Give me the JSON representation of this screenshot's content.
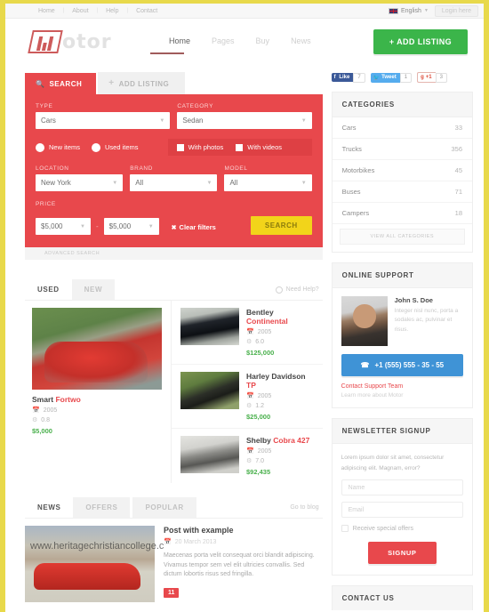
{
  "topbar": {
    "nav": [
      "Home",
      "About",
      "Help",
      "Contact"
    ],
    "language": "English",
    "login": "Login here"
  },
  "header": {
    "logo_text": "otor",
    "nav": [
      {
        "label": "Home",
        "active": true
      },
      {
        "label": "Pages",
        "active": false
      },
      {
        "label": "Buy",
        "active": false
      },
      {
        "label": "News",
        "active": false
      }
    ],
    "add_listing": "+ ADD LISTING"
  },
  "search": {
    "tab_search": "SEARCH",
    "tab_add_listing": "ADD LISTING",
    "type_label": "TYPE",
    "type_value": "Cars",
    "category_label": "CATEGORY",
    "category_value": "Sedan",
    "new_items": "New items",
    "used_items": "Used items",
    "with_photos": "With photos",
    "with_videos": "With videos",
    "location_label": "LOCATION",
    "location_value": "New York",
    "brand_label": "BRAND",
    "brand_value": "All",
    "model_label": "MODEL",
    "model_value": "All",
    "price_label": "PRICE",
    "price_min": "$5,000",
    "price_max": "$5,000",
    "clear_filters": "Clear filters",
    "search_button": "SEARCH",
    "advanced_search": "ADVANCED SEARCH"
  },
  "listings": {
    "tabs": [
      {
        "label": "USED",
        "active": true
      },
      {
        "label": "NEW",
        "active": false
      }
    ],
    "need_help": "Need Help?",
    "featured": {
      "brand": "Smart",
      "model": "Fortwo",
      "year": "2005",
      "engine": "0.8",
      "price": "$5,000"
    },
    "items": [
      {
        "brand": "Bentley",
        "model": "Continental",
        "year": "2005",
        "engine": "6.0",
        "price": "$125,000",
        "thumb": "bentley"
      },
      {
        "brand": "Harley Davidson",
        "model": "TP",
        "year": "2005",
        "engine": "1.2",
        "price": "$25,000",
        "thumb": "harley"
      },
      {
        "brand": "Shelby",
        "model": "Cobra 427",
        "year": "2005",
        "engine": "7.0",
        "price": "$92,435",
        "thumb": "shelby"
      }
    ]
  },
  "news": {
    "tabs": [
      {
        "label": "NEWS",
        "active": true
      },
      {
        "label": "OFFERS",
        "active": false
      },
      {
        "label": "POPULAR",
        "active": false
      }
    ],
    "goto_blog": "Go to blog",
    "post": {
      "title": "Post with example",
      "date": "20 March 2013",
      "excerpt": "Maecenas porta velit consequat orci blandit adipiscing. Vivamus tempor sem vel elit ultricies convallis. Sed dictum lobortis risus sed fringilla.",
      "comments": "11"
    },
    "watermark": "www.heritagechristiancollege.c"
  },
  "sidebar": {
    "social": [
      {
        "network": "Like",
        "count": "7"
      },
      {
        "network": "Tweet",
        "count": "1"
      },
      {
        "network": "+1",
        "count": "3"
      }
    ],
    "categories": {
      "title": "CATEGORIES",
      "items": [
        {
          "label": "Cars",
          "count": "33"
        },
        {
          "label": "Trucks",
          "count": "356"
        },
        {
          "label": "Motorbikes",
          "count": "45"
        },
        {
          "label": "Buses",
          "count": "71"
        },
        {
          "label": "Campers",
          "count": "18"
        }
      ],
      "view_all": "VIEW ALL CATEGORIES"
    },
    "support": {
      "title": "ONLINE SUPPORT",
      "name": "John S. Doe",
      "description": "Integer nisl nunc, porta a sodales ac, pulvinar et risus.",
      "phone": "+1 (555) 555 - 35 - 55",
      "link": "Contact Support Team",
      "sub": "Learn more about Motor"
    },
    "newsletter": {
      "title": "NEWSLETTER SIGNUP",
      "text": "Lorem ipsum dolor sit amet, consectetur adipiscing elit. Magnam, error?",
      "name_placeholder": "Name",
      "email_placeholder": "Email",
      "checkbox_label": "Receive special offers",
      "button": "SIGNUP"
    },
    "bottom_widget_title": "CONTACT US"
  }
}
